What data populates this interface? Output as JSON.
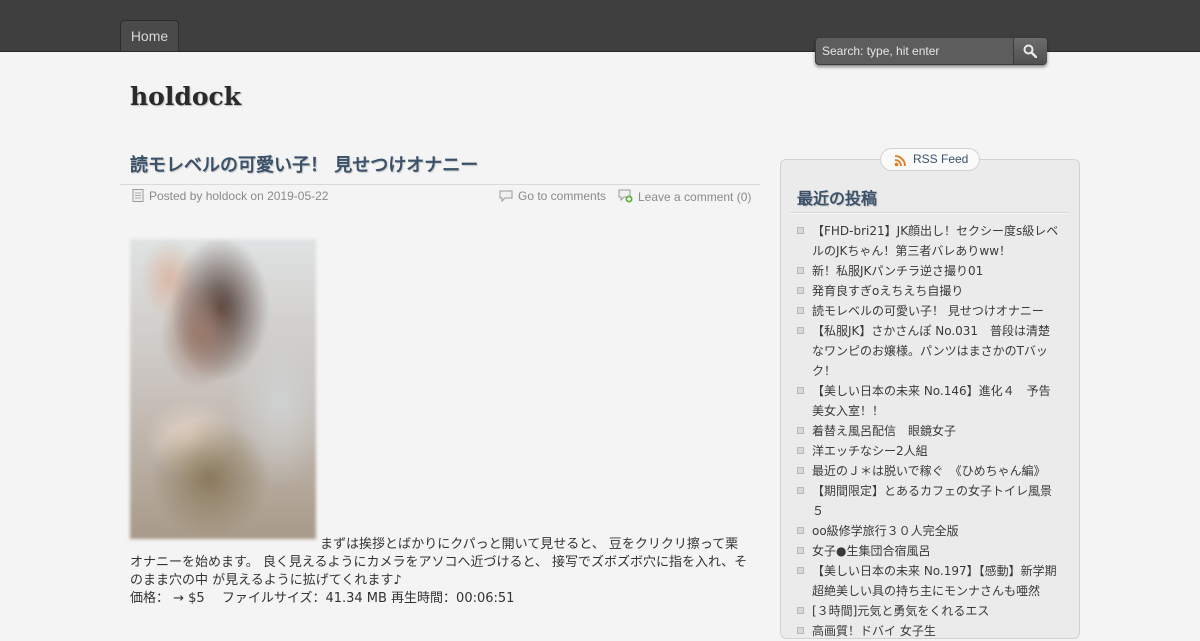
{
  "nav": {
    "home_label": "Home"
  },
  "search": {
    "placeholder": "Search: type, hit enter"
  },
  "site": {
    "title": "holdock"
  },
  "post": {
    "title": "読モレベルの可愛い子！ 見せつけオナニー",
    "meta": {
      "posted": "Posted by holdock on 2019-05-22",
      "go_to_comments": "Go to comments",
      "leave_comment": "Leave a comment (0)"
    },
    "body_line1": "まずは挨拶とばかりにクパっと開いて見せると、 豆をクリクリ擦って栗",
    "body_line2": "オナニーを始めます。 良く見えるようにカメラをアソコへ近づけると、 接写でズボズボ穴に指を入れ、そのまま穴の中 が見えるように拡げてくれます♪",
    "price_line": "価格： → $5　 ファイルサイズ：41.34 MB 再生時間：00:06:51"
  },
  "sidebar": {
    "rss_label": "RSS Feed",
    "widget_title": "最近の投稿",
    "recent_posts": [
      "【FHD-bri21】JK顔出し！セクシー度s級レベルのJKちゃん！第三者バレありww！",
      "新！私服JKパンチラ逆さ撮り01",
      "発育良すぎoえちえち自撮り",
      "読モレベルの可愛い子！ 見せつけオナニー",
      "【私服JK】さかさんぽ No.031　普段は清楚なワンピのお嬢様。パンツはまさかのTバック！",
      "【美しい日本の未来 No.146】進化４　予告美女入室！！",
      "着替え風呂配信　眼鏡女子",
      "洋エッチなシー2人組",
      "最近のＪ＊は脱いで稼ぐ　《ひめちゃん編》",
      "【期間限定】とあるカフェの女子トイレ風景５",
      "oo級修学旅行３０人完全版",
      "女子●生集団合宿風呂",
      "【美しい日本の未来 No.197】【感動】新学期　超絶美しい具の持ち主にモンナさんも唖然",
      "[３時間]元気と勇気をくれるエス",
      "高画質！ドバイ 女子生"
    ]
  },
  "colors": {
    "topbar": "#3f3f3f",
    "background": "#f4f4f4",
    "title_blue": "#3a5169"
  },
  "icons": {
    "search": "magnifier-icon",
    "posted": "document-icon",
    "comments": "speech-bubble-icon",
    "leave": "comment-add-icon",
    "rss": "rss-icon"
  }
}
